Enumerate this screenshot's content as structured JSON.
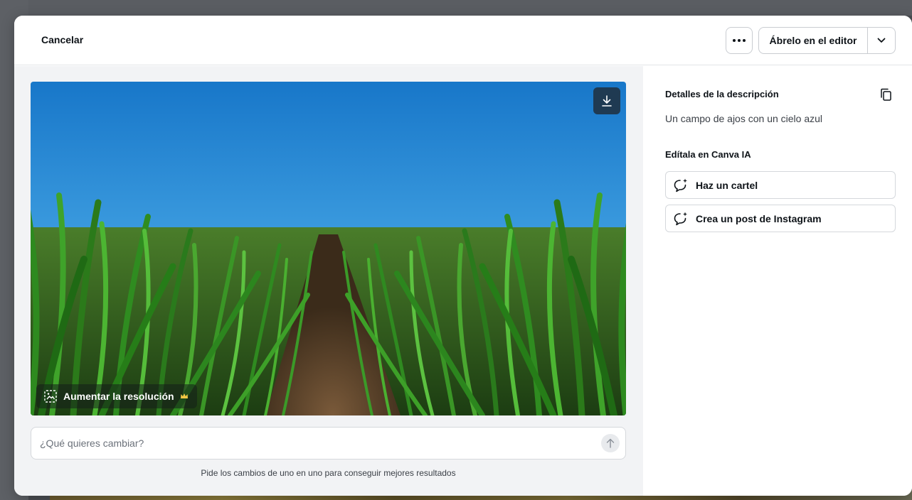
{
  "header": {
    "cancel_label": "Cancelar",
    "more_icon": "more-horizontal-icon",
    "open_editor_label": "Ábrelo en el editor",
    "caret_icon": "chevron-down-icon"
  },
  "image": {
    "upscale_label": "Aumentar la resolución",
    "download_icon": "download-icon",
    "upscale_icon": "image-upscale-icon",
    "premium_icon": "crown-icon"
  },
  "prompt": {
    "placeholder": "¿Qué quieres cambiar?",
    "hint": "Pide los cambios de uno en uno para conseguir mejores resultados"
  },
  "details": {
    "title": "Detalles de la descripción",
    "description": "Un campo de ajos con un cielo azul",
    "copy_icon": "copy-icon"
  },
  "edit_ai": {
    "title": "Edítala en Canva IA",
    "actions": [
      {
        "label": "Haz un cartel",
        "icon": "sparkle-chat-icon"
      },
      {
        "label": "Crea un post de Instagram",
        "icon": "sparkle-chat-icon"
      }
    ]
  },
  "colors": {
    "accent_dark": "#1f3a52",
    "panel_bg": "#f2f3f5",
    "text": "#0e1318"
  }
}
